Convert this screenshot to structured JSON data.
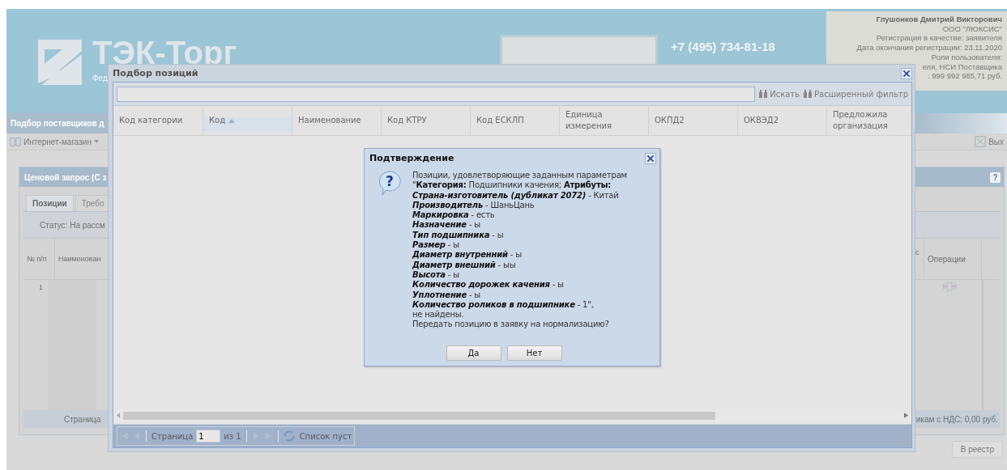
{
  "page": {
    "brand": {
      "name": "ТЭК-Торг",
      "subtitle": "Фед"
    },
    "phone": "+7 (495) 734-81-18",
    "user_panel": {
      "name": "Глушонков Дмитрий Викторович",
      "lines": [
        "ООО \"ЛЮКСИС\"",
        "Регистрация в качестве: заявителя",
        "Дата окончания регистрации: 23.11.2020",
        "Роли пользователя:",
        "еля, НСИ Поставщика",
        ": 999 992 985,71 руб."
      ]
    },
    "section_title": "Подбор поставщиков д",
    "toolbar": {
      "left": "Интернет-магазин",
      "right": "Вых"
    },
    "panel": {
      "title": "Ценовой запрос (С з",
      "help": "?",
      "tabs": [
        {
          "label": "Позиции",
          "selected": true
        },
        {
          "label": "Требо",
          "selected": false
        }
      ],
      "status": "Статус: На рассм",
      "columns_left": [
        "№ п/п",
        "Наименован"
      ],
      "columns_right": [
        "с",
        "Операции"
      ],
      "rows": [
        {
          "number": "1"
        }
      ],
      "pager_label": "Страница",
      "total": "икам с НДС: 0,00 руб."
    },
    "registry_button": "В реестр"
  },
  "picker": {
    "title": "Подбор позиций",
    "search_button": "Искать",
    "filter_button": "Расширенный фильтр",
    "columns": [
      {
        "label": "Код категории",
        "sorted": false
      },
      {
        "label": "Код",
        "sorted": true
      },
      {
        "label": "Наименование",
        "sorted": false
      },
      {
        "label": "Код КТРУ",
        "sorted": false
      },
      {
        "label": "Код ЕСКЛП",
        "sorted": false
      },
      {
        "label": "Единица измерения",
        "sorted": false
      },
      {
        "label": "ОКПД2",
        "sorted": false
      },
      {
        "label": "ОКВЭД2",
        "sorted": false
      },
      {
        "label": "Предложила организация",
        "sorted": false
      }
    ],
    "pager": {
      "page_label": "Страница",
      "page": "1",
      "of": "из 1",
      "status": "Список пуст"
    }
  },
  "confirm": {
    "title": "Подтверждение",
    "icon": "?",
    "message": [
      "Позиции, удовлетворяющие заданным параметрам",
      "\"**Категория:** Подшипники качения; **Атрибуты:**",
      "*Страна-изготовитель (дубликат 2072)* - Китай",
      "*Производитель* - ШаньЦань",
      "*Маркировка* - есть",
      "*Назначение* - ы",
      "*Тип подшипника* - ы",
      "*Размер* - ы",
      "*Диаметр внутренний* - ы",
      "*Диаметр внешний* - ыы",
      "*Высота* - ы",
      "*Количество дорожек качения* - ы",
      "*Уплотнение* - ы",
      "*Количество роликов в подшипнике* - 1\",",
      "не найдены.",
      "Передать позицию в заявку на нормализацию?"
    ],
    "buttons": [
      "Да",
      "Нет"
    ]
  }
}
